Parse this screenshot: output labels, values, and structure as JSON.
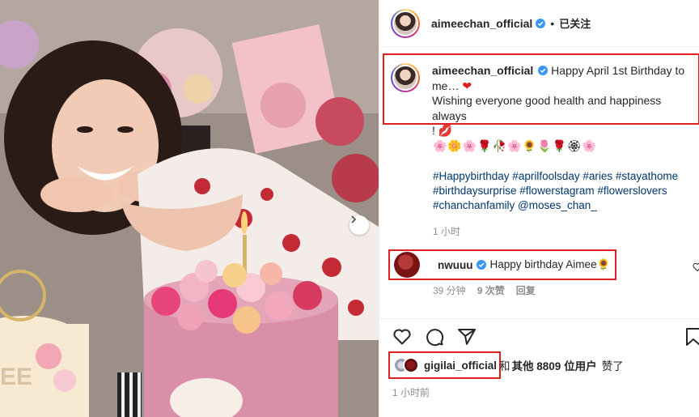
{
  "post": {
    "author": "aimeechan_official",
    "dot": "•",
    "follow_status": "已关注"
  },
  "caption": {
    "author": "aimeechan_official",
    "line1": "Happy April 1st Birthday to",
    "line2": "me…",
    "line3": "Wishing everyone good health and happiness always",
    "line4": "!",
    "emoji_row": "🌸🌼🌸🌹🥀🌸🌻🌷🌹🏵🌸",
    "hashtags": "#Happybirthday #aprilfoolsday #aries #stayathome #birthdaysurprise #flowerstagram #flowerslovers #chanchanfamily @moses_chan_",
    "time": "1 小时"
  },
  "comment": {
    "author": "nwuuu",
    "text": "Happy birthday Aimee🌻",
    "time": "39 分钟",
    "likes": "9 次赞",
    "reply": "回复"
  },
  "likes": {
    "user": "gigilai_official",
    "and": "和",
    "others": "其他 8809 位用户",
    "liked": "赞了"
  },
  "time_posted": "1 小时前",
  "colors": {
    "highlight": "#e02020",
    "link": "#00376b",
    "verified": "#3897f0",
    "muted": "#8e8e8e"
  },
  "icons": [
    "verified-icon",
    "heart-icon",
    "comment-icon",
    "share-icon",
    "bookmark-icon",
    "chevron-right-icon",
    "small-heart-icon"
  ]
}
